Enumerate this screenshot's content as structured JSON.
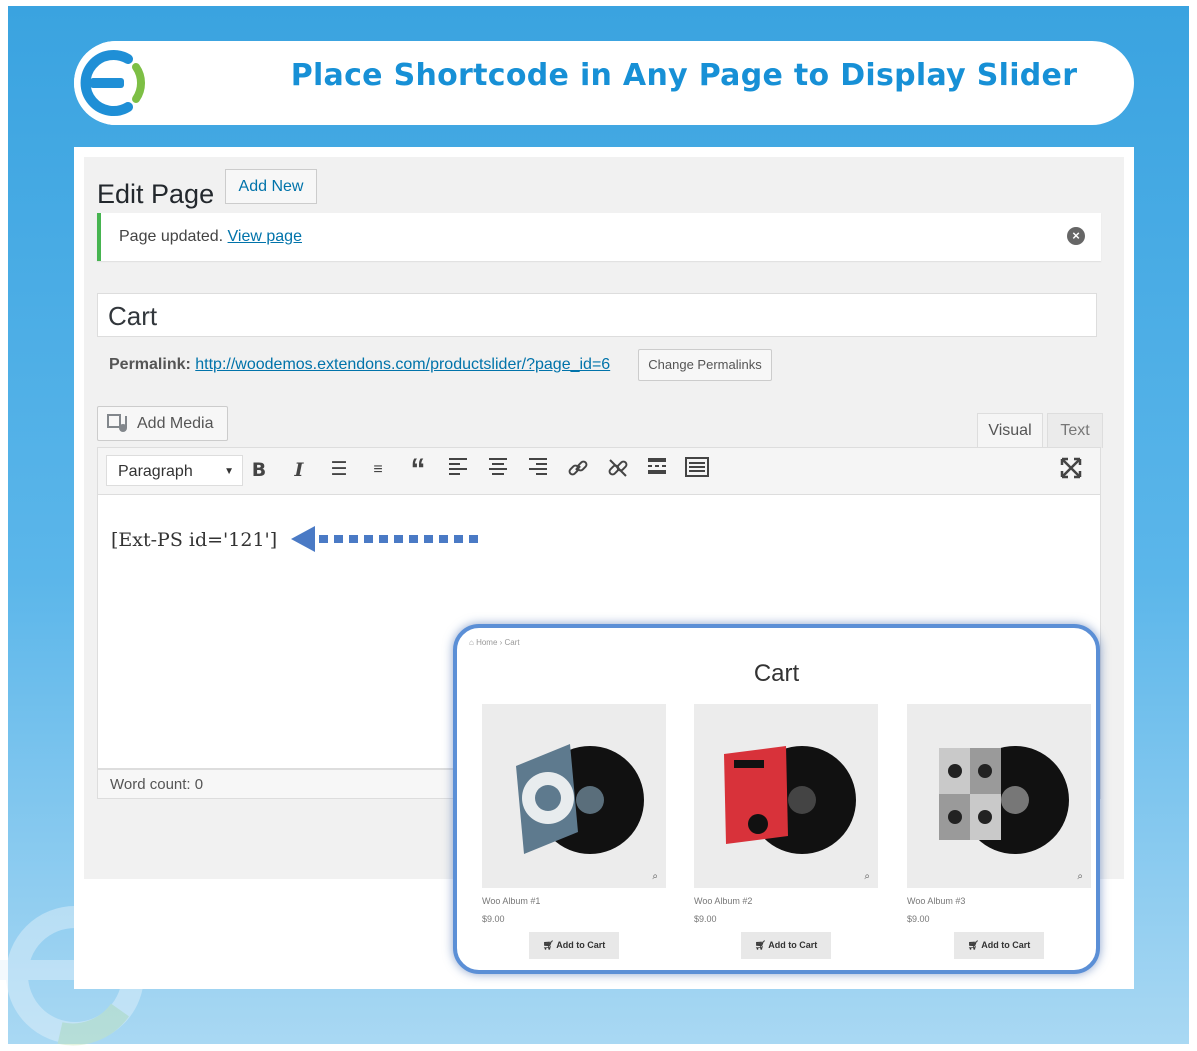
{
  "banner": {
    "title": "Place Shortcode in Any Page to Display Slider"
  },
  "colors": {
    "accent": "#1790d6",
    "wp_link": "#0073aa",
    "notice_green": "#46b450",
    "arrow_blue": "#4a7ac5"
  },
  "editor_page": {
    "heading": "Edit Page",
    "add_new_label": "Add New",
    "notice": {
      "text": "Page updated.",
      "link": "View page"
    },
    "post_title": "Cart",
    "permalink": {
      "label": "Permalink:",
      "url": "http://woodemos.extendons.com/productslider/?page_id=6",
      "button": "Change Permalinks"
    },
    "add_media_label": "Add Media",
    "tabs": {
      "visual": "Visual",
      "text": "Text"
    },
    "format_select": "Paragraph",
    "toolbar_icons": [
      "bold-icon",
      "italic-icon",
      "bullet-list-icon",
      "numbered-list-icon",
      "blockquote-icon",
      "align-left-icon",
      "align-center-icon",
      "align-right-icon",
      "link-icon",
      "unlink-icon",
      "read-more-icon",
      "toolbar-toggle-icon",
      "fullscreen-icon"
    ],
    "content": "[Ext-PS id='121']",
    "word_count": "Word count: 0"
  },
  "preview": {
    "breadcrumb": "Home › Cart",
    "page_title": "Cart",
    "products": [
      {
        "name": "Woo Album #1",
        "price": "$9.00",
        "button": "Add to Cart"
      },
      {
        "name": "Woo Album #2",
        "price": "$9.00",
        "button": "Add to Cart"
      },
      {
        "name": "Woo Album #3",
        "price": "$9.00",
        "button": "Add to Cart"
      }
    ]
  }
}
